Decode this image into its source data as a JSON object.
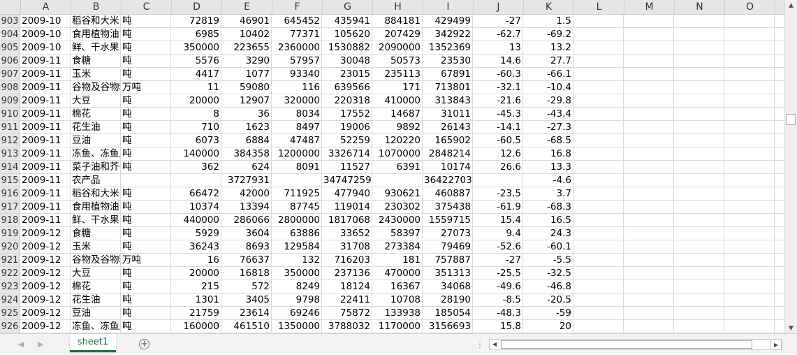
{
  "columns": [
    "A",
    "B",
    "C",
    "D",
    "E",
    "F",
    "G",
    "H",
    "I",
    "J",
    "K",
    "L",
    "M",
    "O"
  ],
  "rows": [
    {
      "n": "903",
      "A": "2009-10",
      "B": "稻谷和大米",
      "C": "吨",
      "D": "72819",
      "E": "46901",
      "F": "645452",
      "G": "435941",
      "H": "884181",
      "I": "429499",
      "J": "-27",
      "K": "1.5"
    },
    {
      "n": "904",
      "A": "2009-10",
      "B": "食用植物油",
      "C": "吨",
      "D": "6985",
      "E": "10402",
      "F": "77371",
      "G": "105620",
      "H": "207429",
      "I": "342922",
      "J": "-62.7",
      "K": "-69.2"
    },
    {
      "n": "905",
      "A": "2009-10",
      "B": "鲜、干水果",
      "C": "吨",
      "D": "350000",
      "E": "223655",
      "F": "2360000",
      "G": "1530882",
      "H": "2090000",
      "I": "1352369",
      "J": "13",
      "K": "13.2"
    },
    {
      "n": "906",
      "A": "2009-11",
      "B": "食糖",
      "C": "吨",
      "D": "5576",
      "E": "3290",
      "F": "57957",
      "G": "30048",
      "H": "50573",
      "I": "23530",
      "J": "14.6",
      "K": "27.7"
    },
    {
      "n": "907",
      "A": "2009-11",
      "B": "玉米",
      "C": "吨",
      "D": "4417",
      "E": "1077",
      "F": "93340",
      "G": "23015",
      "H": "235113",
      "I": "67891",
      "J": "-60.3",
      "K": "-66.1"
    },
    {
      "n": "908",
      "A": "2009-11",
      "B": "谷物及谷物粉",
      "C": "万吨",
      "D": "11",
      "E": "59080",
      "F": "116",
      "G": "639566",
      "H": "171",
      "I": "713801",
      "J": "-32.1",
      "K": "-10.4"
    },
    {
      "n": "909",
      "A": "2009-11",
      "B": "大豆",
      "C": "吨",
      "D": "20000",
      "E": "12907",
      "F": "320000",
      "G": "220318",
      "H": "410000",
      "I": "313843",
      "J": "-21.6",
      "K": "-29.8"
    },
    {
      "n": "910",
      "A": "2009-11",
      "B": "棉花",
      "C": "吨",
      "D": "8",
      "E": "36",
      "F": "8034",
      "G": "17552",
      "H": "14687",
      "I": "31011",
      "J": "-45.3",
      "K": "-43.4"
    },
    {
      "n": "911",
      "A": "2009-11",
      "B": "花生油",
      "C": "吨",
      "D": "710",
      "E": "1623",
      "F": "8497",
      "G": "19006",
      "H": "9892",
      "I": "26143",
      "J": "-14.1",
      "K": "-27.3"
    },
    {
      "n": "912",
      "A": "2009-11",
      "B": "豆油",
      "C": "吨",
      "D": "6073",
      "E": "6884",
      "F": "47487",
      "G": "52259",
      "H": "120220",
      "I": "165902",
      "J": "-60.5",
      "K": "-68.5"
    },
    {
      "n": "913",
      "A": "2009-11",
      "B": "冻鱼、冻鱼片",
      "C": "吨",
      "D": "140000",
      "E": "384358",
      "F": "1200000",
      "G": "3326714",
      "H": "1070000",
      "I": "2848214",
      "J": "12.6",
      "K": "16.8"
    },
    {
      "n": "914",
      "A": "2009-11",
      "B": "菜子油和芥子油",
      "C": "吨",
      "D": "362",
      "E": "624",
      "F": "8091",
      "G": "11527",
      "H": "6391",
      "I": "10174",
      "J": "26.6",
      "K": "13.3"
    },
    {
      "n": "915",
      "A": "2009-11",
      "B": "农产品",
      "C": "",
      "D": "",
      "E": "3727931",
      "F": "",
      "G": "34747259",
      "H": "",
      "I": "36422703",
      "J": "",
      "K": "-4.6"
    },
    {
      "n": "916",
      "A": "2009-11",
      "B": "稻谷和大米",
      "C": "吨",
      "D": "66472",
      "E": "42000",
      "F": "711925",
      "G": "477940",
      "H": "930621",
      "I": "460887",
      "J": "-23.5",
      "K": "3.7"
    },
    {
      "n": "917",
      "A": "2009-11",
      "B": "食用植物油",
      "C": "吨",
      "D": "10374",
      "E": "13394",
      "F": "87745",
      "G": "119014",
      "H": "230302",
      "I": "375438",
      "J": "-61.9",
      "K": "-68.3"
    },
    {
      "n": "918",
      "A": "2009-11",
      "B": "鲜、干水果",
      "C": "吨",
      "D": "440000",
      "E": "286066",
      "F": "2800000",
      "G": "1817068",
      "H": "2430000",
      "I": "1559715",
      "J": "15.4",
      "K": "16.5"
    },
    {
      "n": "919",
      "A": "2009-12",
      "B": "食糖",
      "C": "吨",
      "D": "5929",
      "E": "3604",
      "F": "63886",
      "G": "33652",
      "H": "58397",
      "I": "27073",
      "J": "9.4",
      "K": "24.3"
    },
    {
      "n": "920",
      "A": "2009-12",
      "B": "玉米",
      "C": "吨",
      "D": "36243",
      "E": "8693",
      "F": "129584",
      "G": "31708",
      "H": "273384",
      "I": "79469",
      "J": "-52.6",
      "K": "-60.1"
    },
    {
      "n": "921",
      "A": "2009-12",
      "B": "谷物及谷物粉",
      "C": "万吨",
      "D": "16",
      "E": "76637",
      "F": "132",
      "G": "716203",
      "H": "181",
      "I": "757887",
      "J": "-27",
      "K": "-5.5"
    },
    {
      "n": "922",
      "A": "2009-12",
      "B": "大豆",
      "C": "吨",
      "D": "20000",
      "E": "16818",
      "F": "350000",
      "G": "237136",
      "H": "470000",
      "I": "351313",
      "J": "-25.5",
      "K": "-32.5"
    },
    {
      "n": "923",
      "A": "2009-12",
      "B": "棉花",
      "C": "吨",
      "D": "215",
      "E": "572",
      "F": "8249",
      "G": "18124",
      "H": "16367",
      "I": "34068",
      "J": "-49.6",
      "K": "-46.8"
    },
    {
      "n": "924",
      "A": "2009-12",
      "B": "花生油",
      "C": "吨",
      "D": "1301",
      "E": "3405",
      "F": "9798",
      "G": "22411",
      "H": "10708",
      "I": "28190",
      "J": "-8.5",
      "K": "-20.5"
    },
    {
      "n": "925",
      "A": "2009-12",
      "B": "豆油",
      "C": "吨",
      "D": "21759",
      "E": "23614",
      "F": "69246",
      "G": "75872",
      "H": "133938",
      "I": "185054",
      "J": "-48.3",
      "K": "-59"
    },
    {
      "n": "926",
      "A": "2009-12",
      "B": "冻鱼、冻鱼片",
      "C": "吨",
      "D": "160000",
      "E": "461510",
      "F": "1350000",
      "G": "3788032",
      "H": "1170000",
      "I": "3156693",
      "J": "15.8",
      "K": "20"
    }
  ],
  "sheet_tabs": [
    "sheet1"
  ],
  "add_sheet_label": "+",
  "accent_color": "#1e7145"
}
